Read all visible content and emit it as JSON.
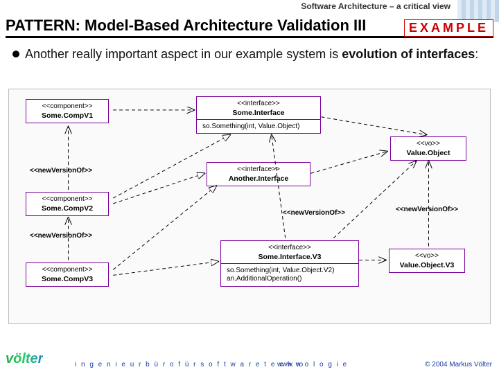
{
  "header": {
    "subtitle": "Software Architecture – a critical view",
    "title": "PATTERN: Model-Based Architecture Validation III",
    "badge": "EXAMPLE"
  },
  "bullet": {
    "lead": "Another really important aspect in our example system is ",
    "bold": "evolution of interfaces",
    "tail": ":"
  },
  "diagram": {
    "boxes": {
      "compV1": {
        "stereo": "<<component>>",
        "name": "Some.CompV1"
      },
      "compV2": {
        "stereo": "<<component>>",
        "name": "Some.CompV2"
      },
      "compV3": {
        "stereo": "<<component>>",
        "name": "Some.CompV3"
      },
      "iface1": {
        "stereo": "<<interface>>",
        "name": "Some.Interface",
        "op": "so.Something(int, Value.Object)"
      },
      "iface2": {
        "stereo": "<<interface>>",
        "name": "Another.Interface"
      },
      "iface3": {
        "stereo": "<<interface>>",
        "name": "Some.Interface.V3",
        "op": "so.Something(int, Value.Object.V2)\nan.AdditionalOperation()"
      },
      "vo1": {
        "stereo": "<<vo>>",
        "name": "Value.Object"
      },
      "vo3": {
        "stereo": "<<vo>>",
        "name": "Value.Object.V3"
      }
    },
    "edgeLabels": {
      "nv1": "<<newVersionOf>>",
      "nv2": "<<newVersionOf>>",
      "nv3": "<<newVersionOf>>",
      "nv4": "<<newVersionOf>>"
    }
  },
  "footer": {
    "logo": "völter",
    "tagline": "i n g e n i e u r b ü r o   f ü r   s o f t w a r e t e c h n o l o g i e",
    "url": "www. vo",
    "copyright": "© 2004  Markus Völter"
  }
}
